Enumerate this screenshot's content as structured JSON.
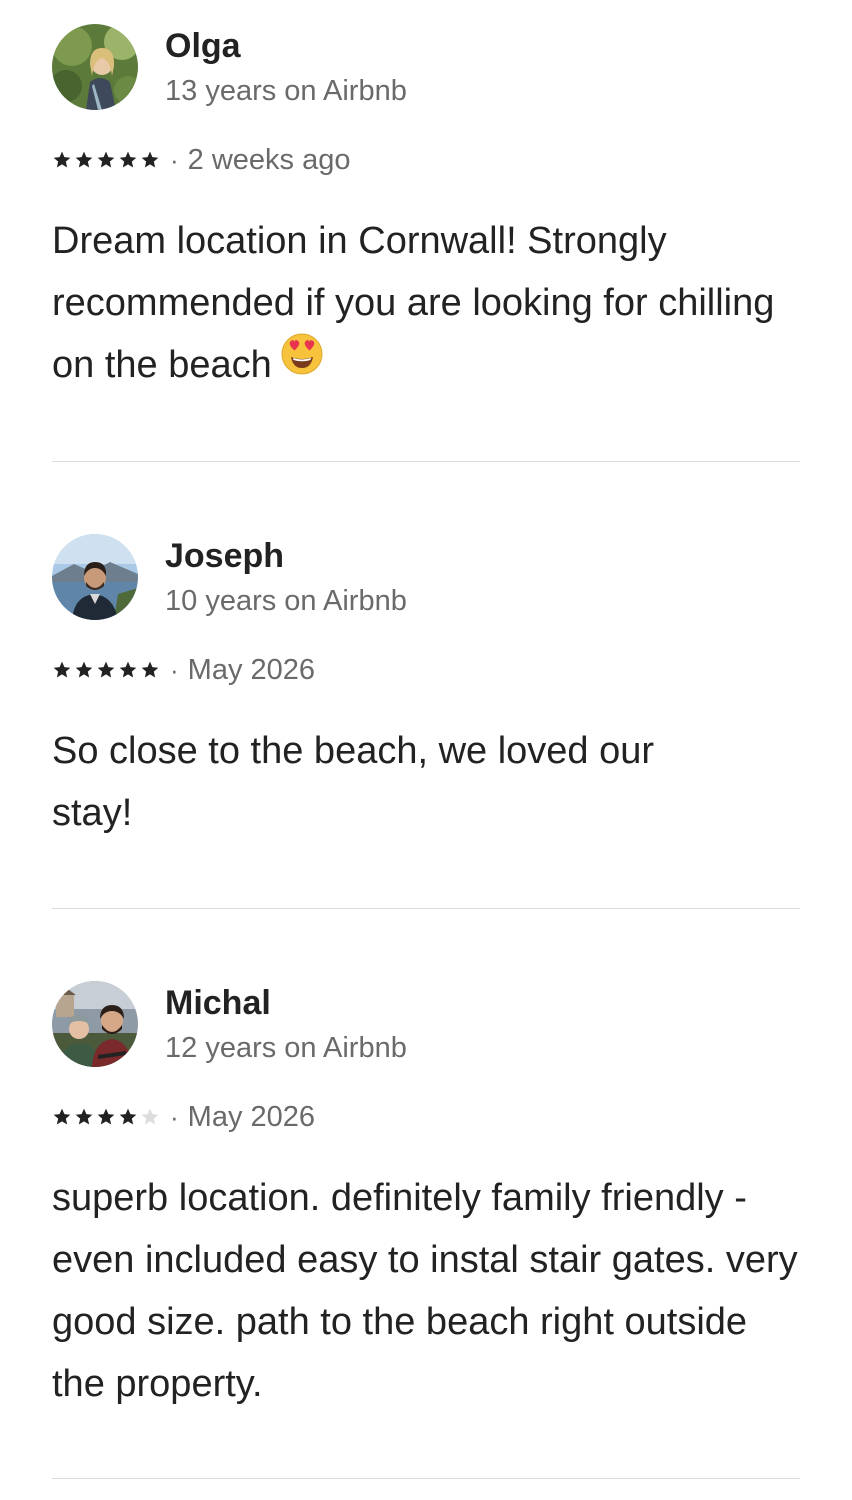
{
  "reviews": [
    {
      "name": "Olga",
      "tenure": "13 years on Airbnb",
      "rating": 5,
      "separator": "·",
      "date": "2 weeks ago",
      "text": "Dream location in Cornwall! Strongly recommended if you are looking for chilling on the beach",
      "emoji": "heart-eyes-emoji"
    },
    {
      "name": "Joseph",
      "tenure": "10 years on Airbnb",
      "rating": 5,
      "separator": "·",
      "date": "May 2026",
      "text": "So close to the beach, we loved our stay!"
    },
    {
      "name": "Michal",
      "tenure": "12 years on Airbnb",
      "rating": 4,
      "separator": "·",
      "date": "May 2026",
      "text": "superb location. definitely family friendly - even included easy to instal stair gates. very good size. path to the beach right outside the property."
    }
  ],
  "colors": {
    "text": "#222222",
    "secondary": "#6a6a6a",
    "star_filled": "#222222",
    "star_empty": "#dddddd",
    "divider": "#dddddd"
  }
}
